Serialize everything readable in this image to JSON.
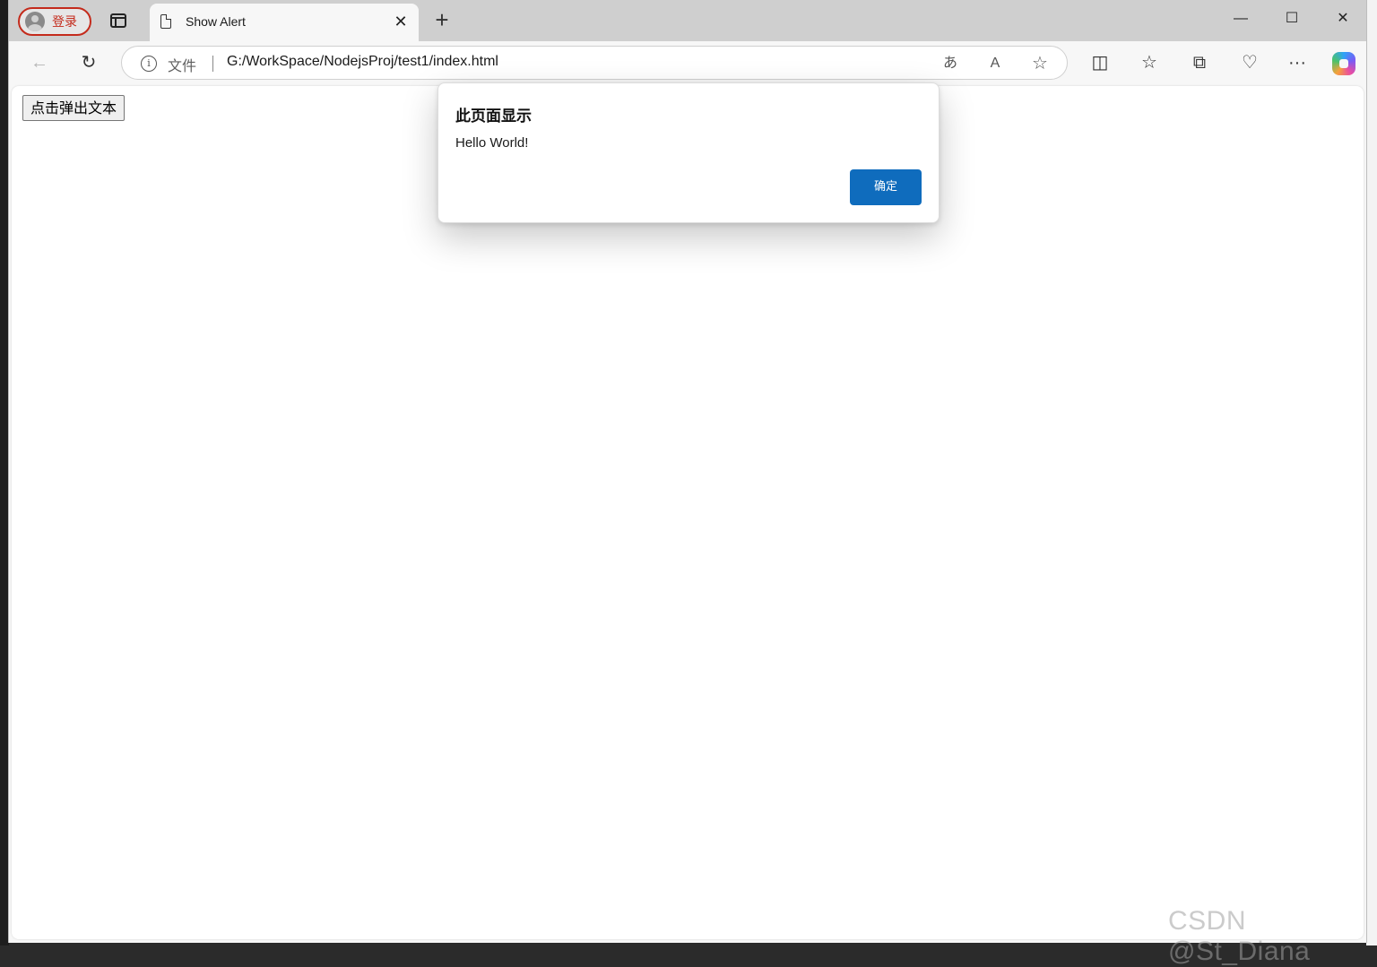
{
  "profile": {
    "label": "登录"
  },
  "tab": {
    "title": "Show Alert",
    "close_glyph": "✕"
  },
  "new_tab_glyph": "+",
  "window_controls": {
    "minimize": "—",
    "maximize": "☐",
    "close": "✕"
  },
  "toolbar": {
    "back_glyph": "←",
    "refresh_glyph": "↻",
    "address": {
      "scheme_label": "文件",
      "url": "G:/WorkSpace/NodejsProj/test1/index.html",
      "translate_glyph": "あ",
      "read_aloud_glyph": "A",
      "favorite_glyph": "☆"
    },
    "split_glyph": "◫",
    "favorites_glyph": "☆",
    "collections_glyph": "⧉",
    "performance_glyph": "♡",
    "more_glyph": "···"
  },
  "page": {
    "button_label": "点击弹出文本"
  },
  "dialog": {
    "title": "此页面显示",
    "message": "Hello World!",
    "ok_label": "确定"
  },
  "watermark": "CSDN @St_Diana",
  "colors": {
    "accent": "#0f6cbd",
    "profile_border": "#c42b1c"
  }
}
